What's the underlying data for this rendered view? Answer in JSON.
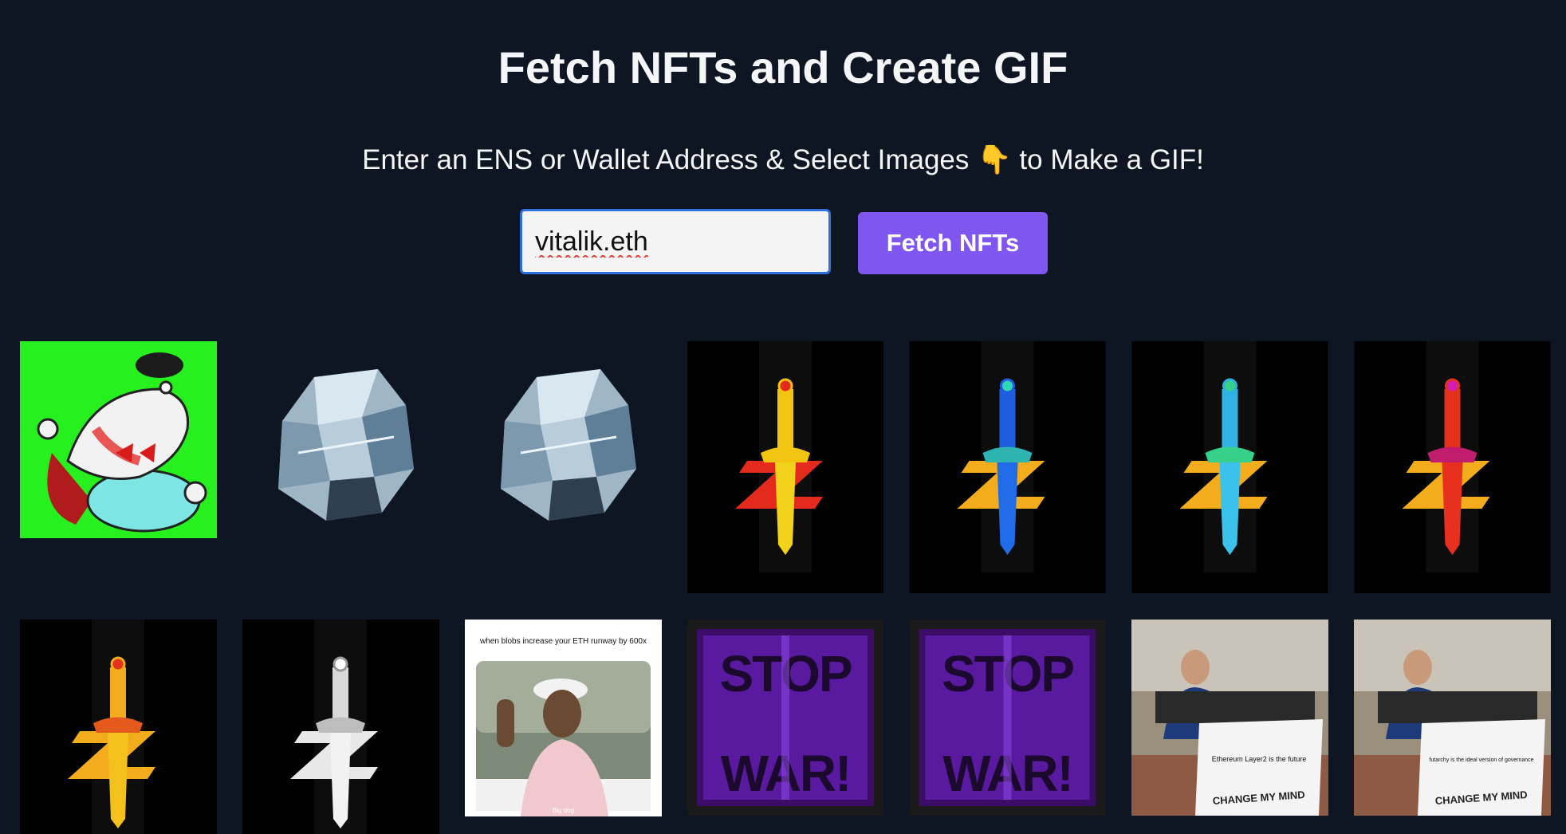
{
  "header": {
    "title": "Fetch NFTs and Create GIF",
    "subtitle": "Enter an ENS or Wallet Address & Select Images 👇 to Make a GIF!"
  },
  "form": {
    "address_value": "vitalik.eth",
    "fetch_label": "Fetch NFTs"
  },
  "nfts": {
    "meme_tiger": {
      "caption": "when blobs increase your ETH runway by 600x",
      "footer": "Big dog"
    },
    "stop_war_1": {
      "text": "STOP WAR!"
    },
    "stop_war_2": {
      "text": "STOP WAR!"
    },
    "change_mind_1": {
      "sign": "Ethereum Layer2 is the future",
      "banner": "CHANGE MY MIND"
    },
    "change_mind_2": {
      "sign": "futarchy is the ideal version of governance",
      "banner": "CHANGE MY MIND"
    }
  },
  "colors": {
    "background": "#0f1623",
    "button": "#8056f0",
    "input_border": "#2f6fde"
  }
}
